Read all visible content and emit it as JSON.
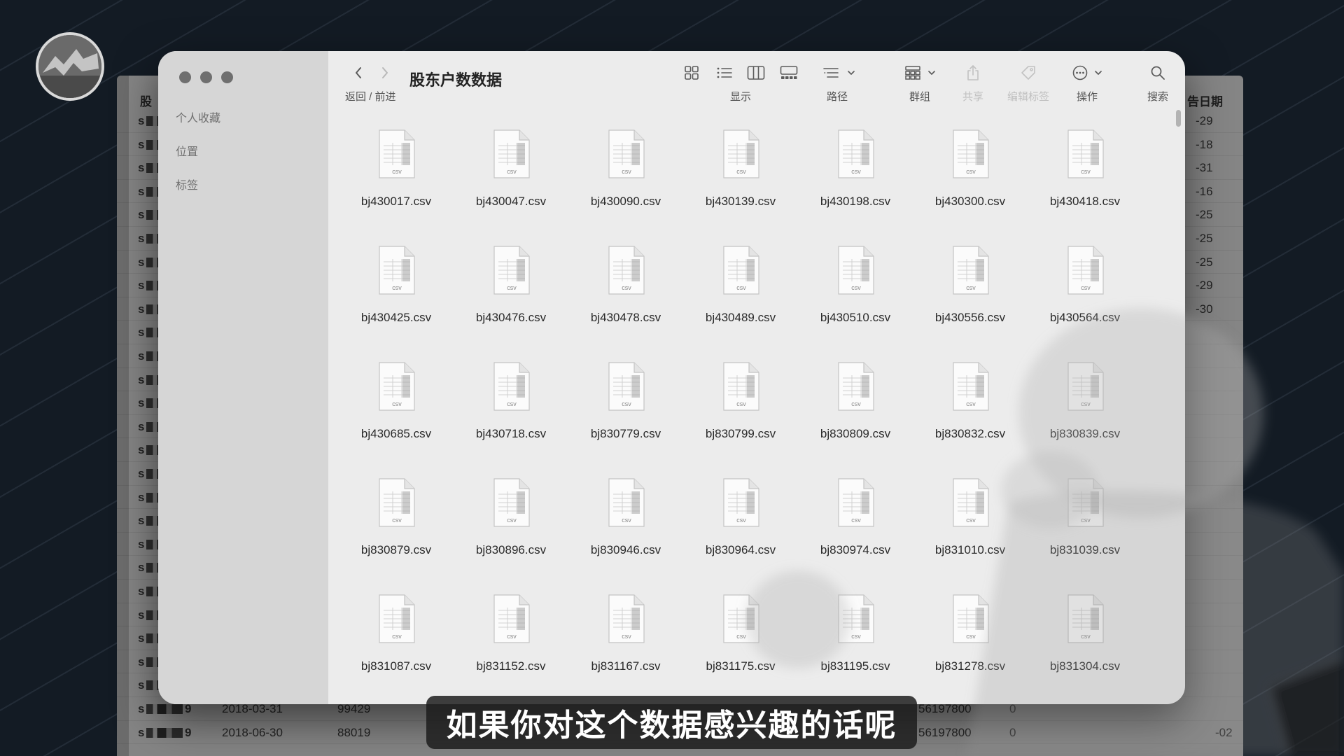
{
  "window": {
    "title": "股东户数数据",
    "nav_label": "返回 / 前进"
  },
  "sidebar": {
    "sections": [
      {
        "label": "个人收藏"
      },
      {
        "label": "位置"
      },
      {
        "label": "标签"
      }
    ]
  },
  "toolbar": {
    "view": {
      "label": "显示",
      "icons": [
        "grid-view-icon",
        "list-view-icon",
        "column-view-icon",
        "gallery-view-icon"
      ]
    },
    "path": {
      "label": "路径",
      "icon": "path-icon"
    },
    "group": {
      "label": "群组",
      "icon": "group-icon"
    },
    "share": {
      "label": "共享",
      "icon": "share-icon",
      "enabled": false
    },
    "tags": {
      "label": "编辑标签",
      "icon": "tag-icon",
      "enabled": false
    },
    "action": {
      "label": "操作",
      "icon": "action-ellipsis-icon"
    },
    "search": {
      "label": "搜索",
      "icon": "search-icon"
    },
    "back_icon": "chevron-left-icon",
    "forward_icon": "chevron-right-icon"
  },
  "file_icon_label": "csv",
  "files": [
    {
      "name": "bj430017.csv"
    },
    {
      "name": "bj430047.csv"
    },
    {
      "name": "bj430090.csv"
    },
    {
      "name": "bj430139.csv"
    },
    {
      "name": "bj430198.csv"
    },
    {
      "name": "bj430300.csv"
    },
    {
      "name": "bj430418.csv"
    },
    {
      "name": "bj430425.csv"
    },
    {
      "name": "bj430476.csv"
    },
    {
      "name": "bj430478.csv"
    },
    {
      "name": "bj430489.csv"
    },
    {
      "name": "bj430510.csv"
    },
    {
      "name": "bj430556.csv"
    },
    {
      "name": "bj430564.csv"
    },
    {
      "name": "bj430685.csv"
    },
    {
      "name": "bj430718.csv"
    },
    {
      "name": "bj830779.csv"
    },
    {
      "name": "bj830799.csv"
    },
    {
      "name": "bj830809.csv"
    },
    {
      "name": "bj830832.csv"
    },
    {
      "name": "bj830839.csv"
    },
    {
      "name": "bj830879.csv"
    },
    {
      "name": "bj830896.csv"
    },
    {
      "name": "bj830946.csv"
    },
    {
      "name": "bj830964.csv"
    },
    {
      "name": "bj830974.csv"
    },
    {
      "name": "bj831010.csv"
    },
    {
      "name": "bj831039.csv"
    },
    {
      "name": "bj831087.csv"
    },
    {
      "name": "bj831152.csv"
    },
    {
      "name": "bj831167.csv"
    },
    {
      "name": "bj831175.csv"
    },
    {
      "name": "bj831195.csv"
    },
    {
      "name": "bj831278.csv"
    },
    {
      "name": "bj831304.csv"
    }
  ],
  "background_table": {
    "header_left": "股",
    "header_right": "告日期",
    "row_prefix": "s",
    "right_column": [
      "-29",
      "-18",
      "-31",
      "-16",
      "-25",
      "-25",
      "-25",
      "-29",
      "-30"
    ],
    "bottom_rows": [
      {
        "code_suffix": "9",
        "date": "2018-03-31",
        "holders": "99429",
        "shares": "56197800",
        "change": "0"
      },
      {
        "code_suffix": "9",
        "date": "2018-06-30",
        "holders": "88019",
        "shares": "56197800",
        "change": "0",
        "announce": "-02"
      }
    ]
  },
  "subtitle": "如果你对这个数据感兴趣的话呢",
  "avatar_icon": "channel-logo-icon",
  "colors": {
    "background": "#131b24",
    "window": "#ececec",
    "sidebar": "#d6d6d6",
    "table": "#858585",
    "subtitle_text": "#ffffff"
  }
}
